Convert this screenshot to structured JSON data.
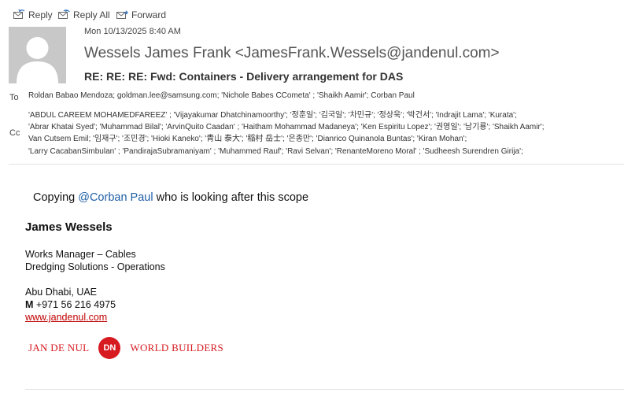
{
  "toolbar": {
    "reply": "Reply",
    "reply_all": "Reply All",
    "forward": "Forward"
  },
  "message": {
    "date": "Mon 10/13/2025 8:40 AM",
    "sender": "Wessels James Frank <JamesFrank.Wessels@jandenul.com>",
    "subject": "RE: RE: RE: Fwd: Containers - Delivery arrangement for DAS",
    "to_label": "To",
    "cc_label": "Cc",
    "to": "Roldan Babao Mendoza; goldman.lee@samsung.com; 'Nichole Babes CCometa'    ; 'Shaikh Aamir'; Corban Paul",
    "cc_lines": [
      "'ABDUL CAREEM MOHAMEDFAREEZ'     ; 'Vijayakumar Dhatchinamoorthy'; '정훈일'; '김국일'; '차민규'; '정상욱'; '박건서'; 'Indrajit Lama'; 'Kurata';",
      "'Abrar Khatai Syed'; 'Muhammad Bilal'; 'ArvinQuito Caadan'    ; 'Haitham Mohammad Madaneya'; 'Ken Espiritu Lopez'; '권영일'; '남기룡'; 'Shaikh Aamir';",
      "Van Cutsem Emil; '임재구'; '조민경'; 'Hioki Kaneko'; '青山 泰大'; '稲村 岳士'; '은종만'; 'Dianrico Quinanola Buntas'; 'Kiran Mohan';",
      "'Larry CacabanSimbulan'    ; 'PandirajaSubramaniyam'    ; 'Muhammed Rauf'; 'Ravi Selvan'; 'RenanteMoreno Moral'    ; 'Sudheesh Surendren Girija';"
    ]
  },
  "body": {
    "copy_prefix": "Copying ",
    "mention": "@Corban Paul",
    "copy_suffix": " who is looking after this scope"
  },
  "signature": {
    "name": "James Wessels",
    "title": "Works Manager – Cables",
    "department": "Dredging Solutions - Operations",
    "location": "Abu Dhabi, UAE",
    "mobile_label": "M",
    "mobile": " +971 56 216 4975",
    "website": "www.jandenul.com",
    "logo_left": "JAN DE NUL",
    "logo_mark": "DN",
    "logo_right": "WORLD BUILDERS"
  },
  "colors": {
    "accent_link": "#c00000",
    "mention": "#1f5fa6",
    "brand_red": "#d71920"
  }
}
